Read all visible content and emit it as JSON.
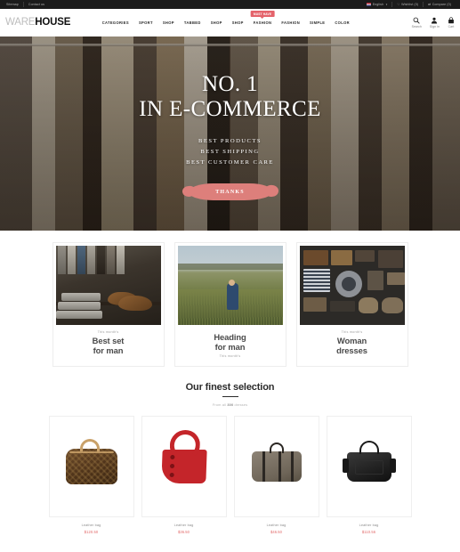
{
  "topbar": {
    "left_links": [
      "Sitemap",
      "Contact us"
    ],
    "language": "English",
    "language_caret": "▾",
    "wishlist": "Wishlist (0)",
    "wishlist_icon": "♡",
    "compare": "Compare (0)",
    "compare_icon": "⇄"
  },
  "header": {
    "logo_light": "WARE",
    "logo_bold": "HOUSE",
    "nav": [
      {
        "label": "CATEGORIES",
        "badge": null
      },
      {
        "label": "SPORT",
        "badge": null
      },
      {
        "label": "SHOP",
        "badge": null
      },
      {
        "label": "TABBED",
        "badge": null
      },
      {
        "label": "SHOP",
        "badge": null
      },
      {
        "label": "SHOP",
        "badge": null
      },
      {
        "label": "FASHION",
        "badge": "Must have"
      },
      {
        "label": "FASHION",
        "badge": null
      },
      {
        "label": "SIMPLE",
        "badge": null
      },
      {
        "label": "COLOR",
        "badge": null
      }
    ],
    "actions": [
      {
        "label": "Search",
        "icon": "search-icon"
      },
      {
        "label": "Sign in",
        "icon": "user-icon"
      },
      {
        "label": "Cart",
        "icon": "cart-icon"
      }
    ]
  },
  "hero": {
    "title_line1": "NO. 1",
    "title_line2": "IN E-COMMERCE",
    "sub_line1": "BEST PRODUCTS",
    "sub_line2": "BEST SHIPPING",
    "sub_line3": "BEST CUSTOMER CARE",
    "button_label": "THANKS",
    "button_color": "#dd7f7b"
  },
  "cards": [
    {
      "kicker": "This month's",
      "title_line1": "Best set",
      "title_line2": "for man",
      "kicker_position": "above",
      "image": "shoes-and-sweaters-photo"
    },
    {
      "kicker": "This month's",
      "title_line1": "Heading",
      "title_line2": "for man",
      "kicker_position": "below",
      "image": "field-with-person-photo"
    },
    {
      "kicker": "This month's",
      "title_line1": "Woman",
      "title_line2": "dresses",
      "kicker_position": "above",
      "image": "accessories-flatlay-photo"
    }
  ],
  "finest": {
    "title": "Our finest selection",
    "sub_prefix": "From all ",
    "sub_count": "300",
    "sub_suffix": " dresses"
  },
  "products": [
    {
      "name": "Leather bag",
      "price": "$120.50",
      "image": "monogram-leather-bag"
    },
    {
      "name": "Leather bag",
      "price": "$36.50",
      "image": "red-shoulder-bag"
    },
    {
      "name": "Leather bag",
      "price": "$46.50",
      "image": "taupe-duffel-bag"
    },
    {
      "name": "Leather bag",
      "price": "$110.56",
      "image": "black-tote-bag"
    }
  ]
}
